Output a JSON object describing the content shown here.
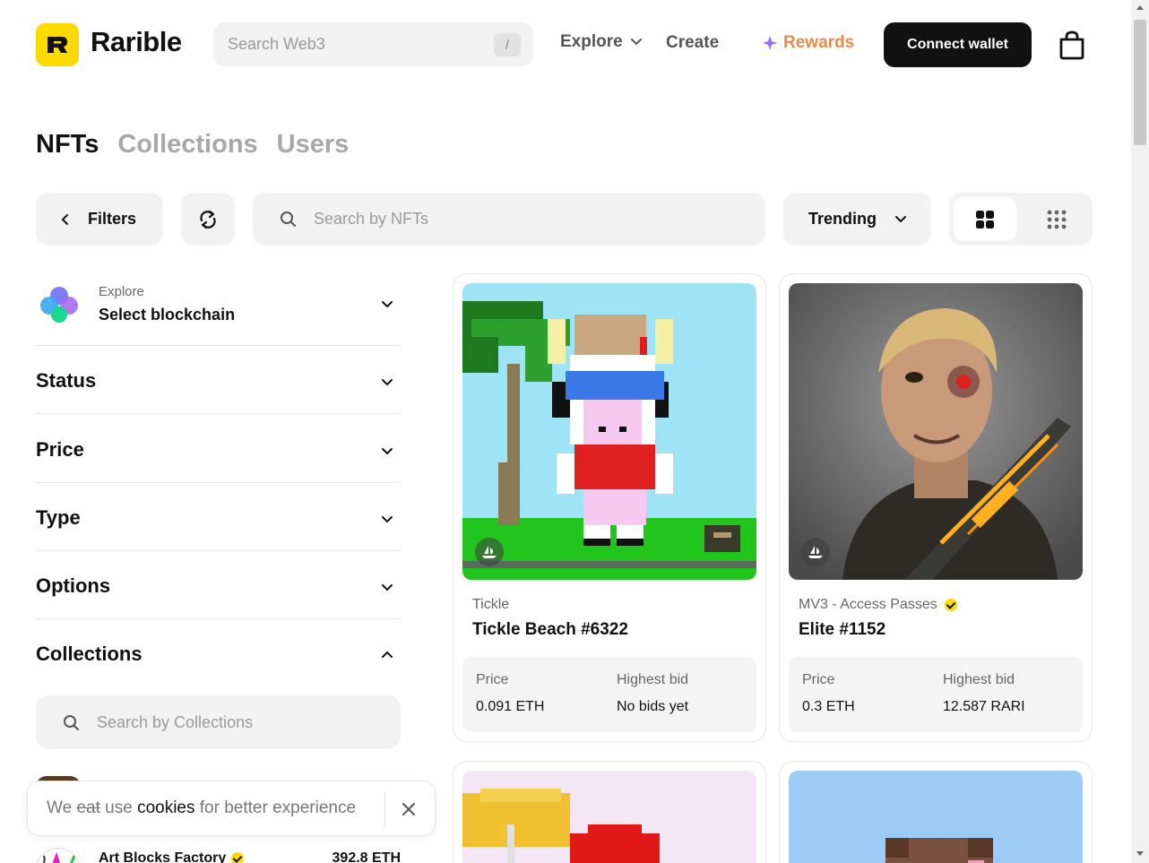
{
  "brand": {
    "name": "Rarible",
    "accent": "#FEDA03"
  },
  "header": {
    "search_placeholder": "Search Web3",
    "search_shortcut": "/",
    "nav_explore": "Explore",
    "nav_create": "Create",
    "nav_rewards": "Rewards",
    "connect_wallet": "Connect wallet"
  },
  "tabs": [
    {
      "label": "NFTs",
      "active": true
    },
    {
      "label": "Collections",
      "active": false
    },
    {
      "label": "Users",
      "active": false
    }
  ],
  "toolbar": {
    "filters_label": "Filters",
    "search_placeholder": "Search by NFTs",
    "sort_label": "Trending"
  },
  "sidebar": {
    "blockchain": {
      "sub": "Explore",
      "main": "Select blockchain"
    },
    "sections": [
      {
        "label": "Status",
        "expanded": false
      },
      {
        "label": "Price",
        "expanded": false
      },
      {
        "label": "Type",
        "expanded": false
      },
      {
        "label": "Options",
        "expanded": false
      },
      {
        "label": "Collections",
        "expanded": true
      }
    ],
    "collections_search_placeholder": "Search by Collections",
    "collections": [
      {
        "name": "Art Blocks Factory",
        "volume": "392.8 ETH"
      }
    ]
  },
  "cookie": {
    "we": "We",
    "struck": "eat",
    "use": "use",
    "cookies": "cookies",
    "rest": "for better experience"
  },
  "cards": [
    {
      "collection": "Tickle",
      "title": "Tickle Beach #6322",
      "verified": false,
      "price_label": "Price",
      "price": "0.091 ETH",
      "bid_label": "Highest bid",
      "bid": "No bids yet"
    },
    {
      "collection": "MV3 - Access Passes",
      "title": "Elite #1152",
      "verified": true,
      "price_label": "Price",
      "price": "0.3 ETH",
      "bid_label": "Highest bid",
      "bid": "12.587 RARI"
    }
  ]
}
